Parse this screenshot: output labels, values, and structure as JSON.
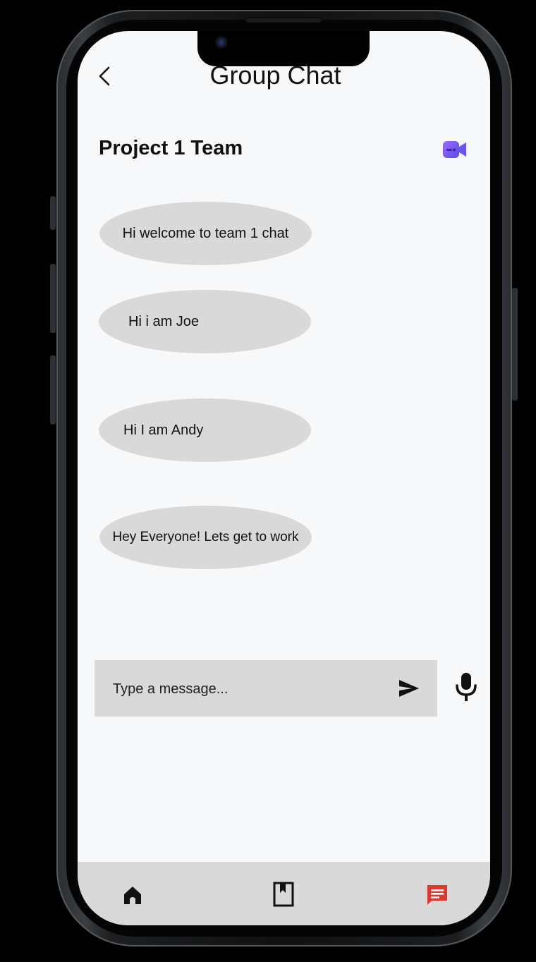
{
  "header": {
    "title": "Group Chat",
    "back_icon": "chevron-left-icon"
  },
  "chat": {
    "name": "Project 1 Team",
    "video_icon": "video-camera-icon",
    "video_icon_color": "#7a5af8"
  },
  "messages": [
    {
      "text": "Hi welcome to team 1 chat"
    },
    {
      "text": "Hi i am Joe"
    },
    {
      "text": "Hi I am Andy"
    },
    {
      "text": "Hey Everyone! Lets get to work"
    }
  ],
  "composer": {
    "placeholder": "Type a message...",
    "send_icon": "send-icon",
    "mic_icon": "microphone-icon"
  },
  "bottom_nav": {
    "items": [
      {
        "name": "home",
        "icon": "home-icon",
        "active": false
      },
      {
        "name": "bookmarks",
        "icon": "bookmark-icon",
        "active": false
      },
      {
        "name": "messages",
        "icon": "chat-icon",
        "active": true
      }
    ],
    "active_color": "#e0362c",
    "inactive_color": "#111111"
  }
}
